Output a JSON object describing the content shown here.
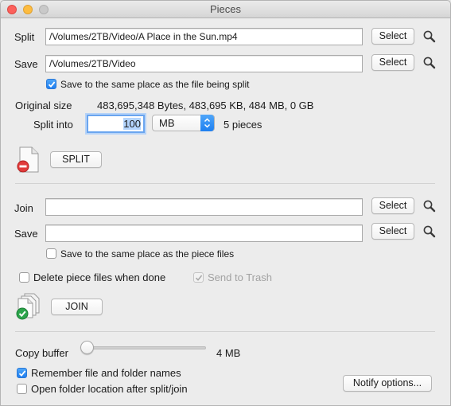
{
  "window": {
    "title": "Pieces"
  },
  "split": {
    "file_label": "Split",
    "file_value": "/Volumes/2TB/Video/A Place in the Sun.mp4",
    "file_select": "Select",
    "save_label": "Save",
    "save_value": "/Volumes/2TB/Video",
    "save_select": "Select",
    "same_place_label": "Save to the same place as the file being split",
    "same_place_checked": true,
    "original_size_label": "Original size",
    "original_size_value": "483,695,348 Bytes, 483,695 KB, 484 MB, 0 GB",
    "split_into_label": "Split into",
    "split_into_value": "100",
    "unit_selected": "MB",
    "pieces_text": "5 pieces",
    "split_button": "SPLIT"
  },
  "join": {
    "join_label": "Join",
    "join_value": "",
    "join_select": "Select",
    "save_label": "Save",
    "save_value": "",
    "save_select": "Select",
    "same_place_label": "Save to the same place as the piece files",
    "same_place_checked": false,
    "delete_label": "Delete piece files when done",
    "delete_checked": false,
    "trash_label": "Send to Trash",
    "trash_checked": true,
    "join_button": "JOIN"
  },
  "settings": {
    "copy_buffer_label": "Copy buffer",
    "copy_buffer_value": "4 MB",
    "copy_buffer_level": 0,
    "remember_label": "Remember file and folder names",
    "remember_checked": true,
    "open_folder_label": "Open folder location after split/join",
    "open_folder_checked": false,
    "notify_button": "Notify options..."
  },
  "icons": {
    "magnifier": "magnifier-icon",
    "split_doc": "split-document-icon",
    "join_docs": "join-documents-icon"
  },
  "colors": {
    "accent": "#1f7ff1",
    "close": "#fc605b",
    "minimize": "#fdbc40"
  }
}
